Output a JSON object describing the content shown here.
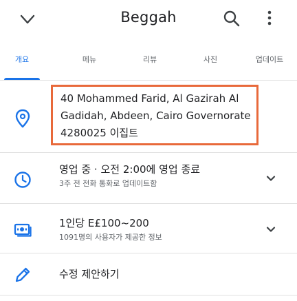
{
  "header": {
    "title": "Beggah",
    "back_icon": "chevron-down-icon",
    "search_icon": "search-icon",
    "more_icon": "more-vert-icon"
  },
  "tabs": [
    {
      "label": "개요",
      "active": true
    },
    {
      "label": "메뉴",
      "active": false
    },
    {
      "label": "리뷰",
      "active": false
    },
    {
      "label": "사진",
      "active": false
    },
    {
      "label": "업데이트",
      "active": false
    }
  ],
  "address": {
    "icon": "location-pin-icon",
    "lines": [
      "40 Mohammed Farid, Al Gazirah Al",
      "Gadidah, Abdeen, Cairo Governorate",
      "4280025 이집트"
    ]
  },
  "hours": {
    "icon": "clock-icon",
    "main": "영업 중 · 오전 2:00에 영업 종료",
    "sub": "3주 전 전화 통화로 업데이트함"
  },
  "price": {
    "icon": "price-icon",
    "main": "1인당 E£100~200",
    "sub": "1091명의 사용자가 제공한 정보"
  },
  "suggest": {
    "icon": "pencil-icon",
    "main": "수정 제안하기"
  },
  "colors": {
    "accent": "#1a73e8",
    "highlight_border": "#e8693a",
    "icon": "#1a73e8"
  }
}
